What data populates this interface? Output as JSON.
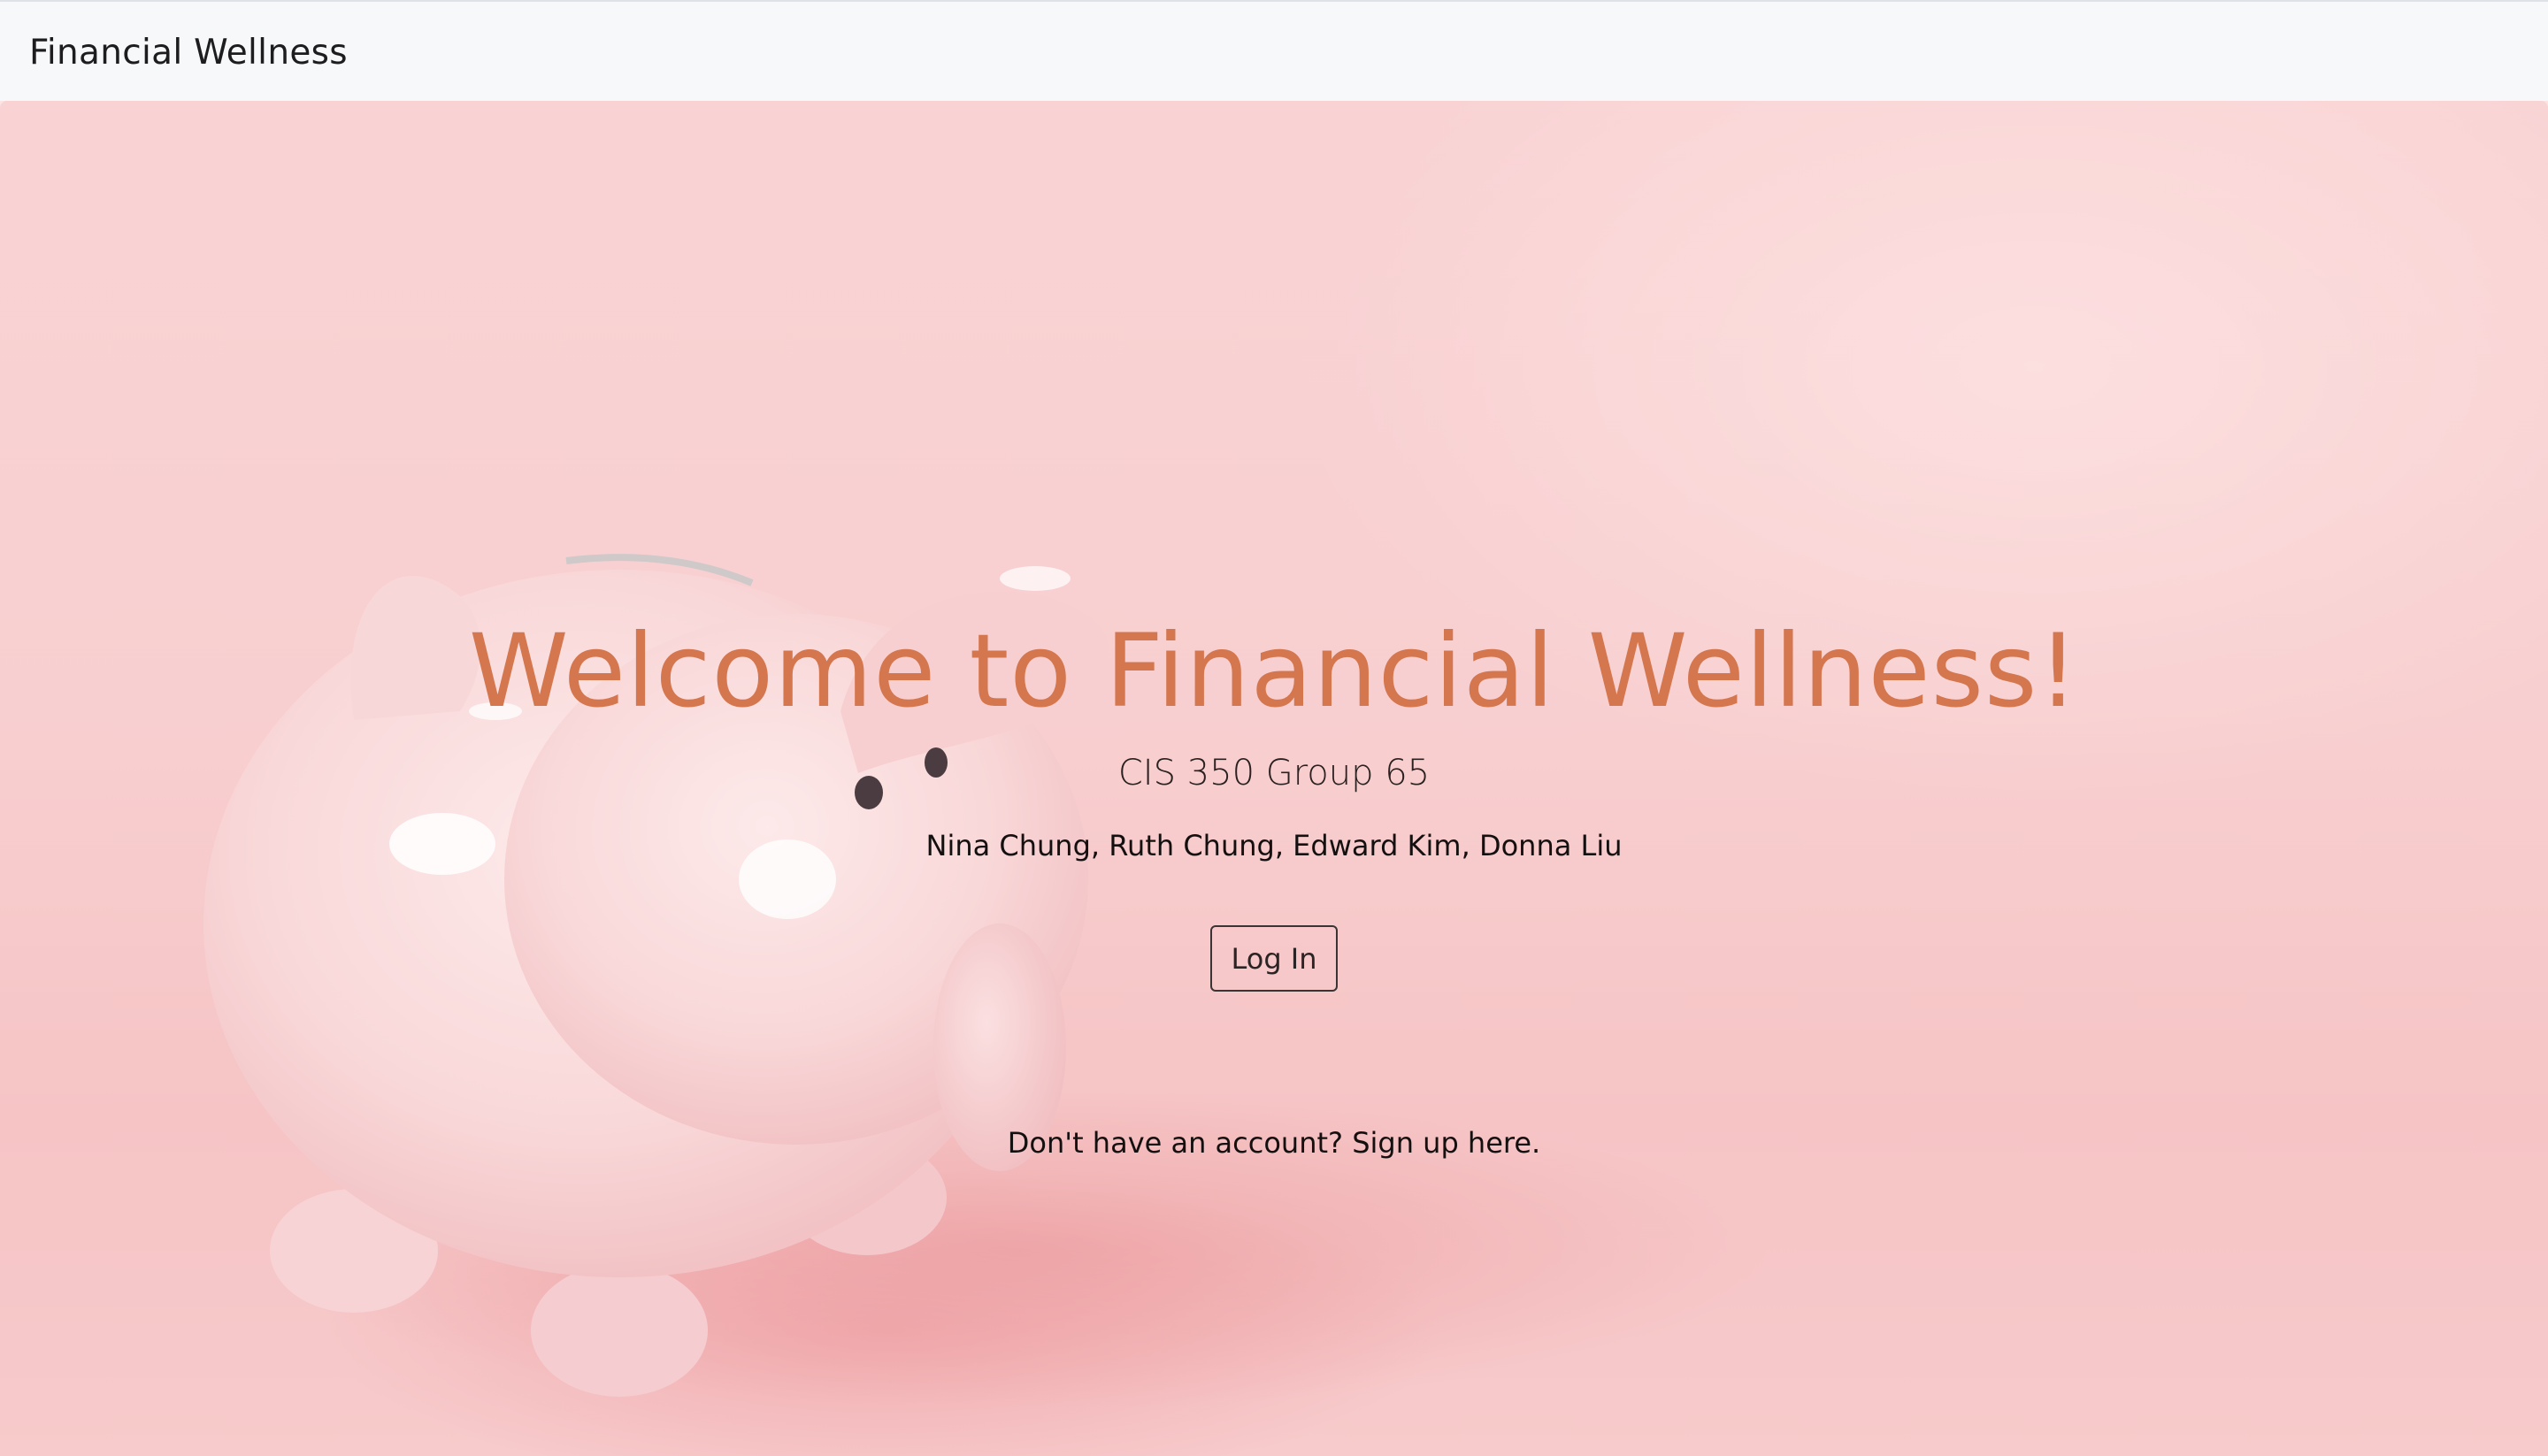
{
  "navbar": {
    "brand": "Financial Wellness"
  },
  "hero": {
    "background_image": "piggy-bank-photo",
    "headline": "Welcome to Financial Wellness!",
    "subtitle": "CIS 350 Group 65",
    "members": "Nina Chung, Ruth Chung, Edward Kim, Donna Liu",
    "login_label": "Log In",
    "signup_prompt": "Don't have an account?",
    "signup_link": "Sign up here."
  },
  "colors": {
    "navbar_bg": "#f7f8fa",
    "hero_bg": "#f8cfd0",
    "headline": "#d4764e",
    "text": "#141010"
  }
}
